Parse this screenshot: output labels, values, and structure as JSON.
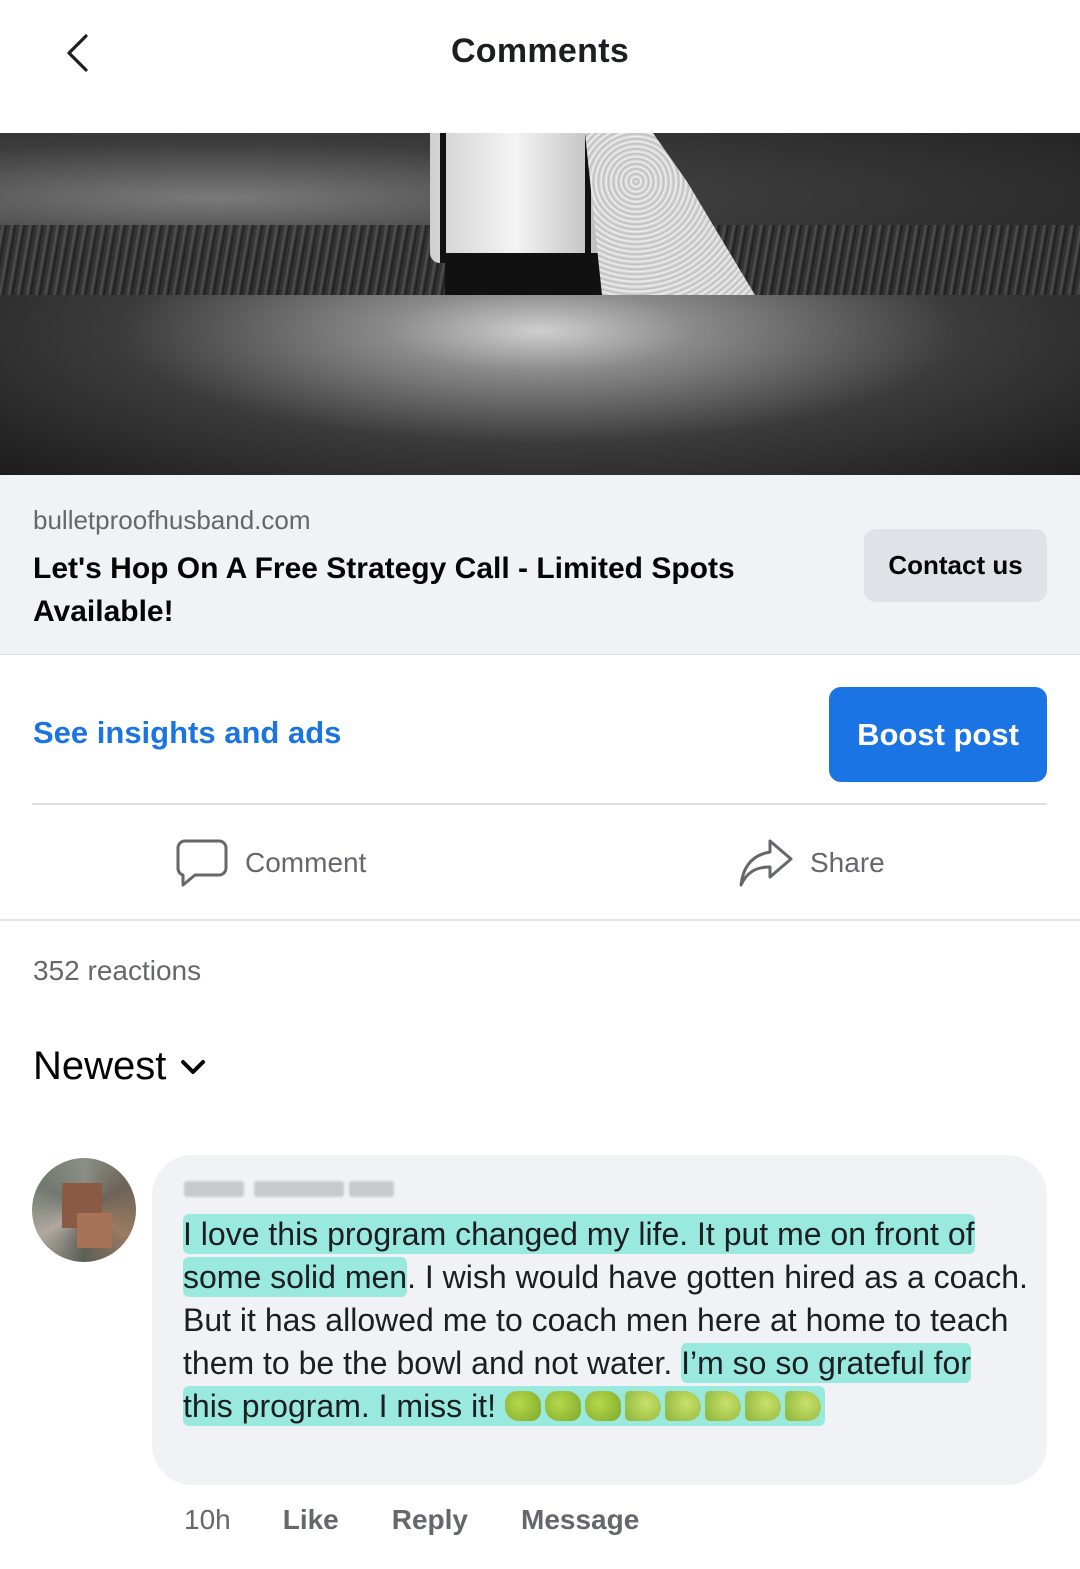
{
  "header": {
    "title": "Comments",
    "back_icon": "chevron-left-icon"
  },
  "link_card": {
    "domain": "bulletproofhusband.com",
    "title": "Let's Hop On A Free Strategy Call - Limited Spots Available!",
    "cta_label": "Contact us"
  },
  "insights": {
    "link_label": "See insights and ads",
    "boost_label": "Boost post"
  },
  "actions": {
    "comment_label": "Comment",
    "share_label": "Share"
  },
  "reactions": {
    "text": "352 reactions"
  },
  "sort": {
    "label": "Newest"
  },
  "comment": {
    "text_highlighted_1": "I love this program changed my life. It put me on front of some solid men",
    "text_plain": ". I wish would have gotten hired as a coach. But it has allowed me to coach men here at home to teach them to be the bowl and not water. ",
    "text_highlighted_2": "I’m so so grateful for this program. I miss it! ",
    "emojis": [
      "fist",
      "fist",
      "fist",
      "muscle",
      "muscle",
      "muscle",
      "muscle",
      "muscle"
    ],
    "time": "10h",
    "like_label": "Like",
    "reply_label": "Reply",
    "message_label": "Message"
  },
  "colors": {
    "accent": "#1b74e4",
    "highlight": "#7ee6d6",
    "bubble": "#f0f2f5"
  }
}
